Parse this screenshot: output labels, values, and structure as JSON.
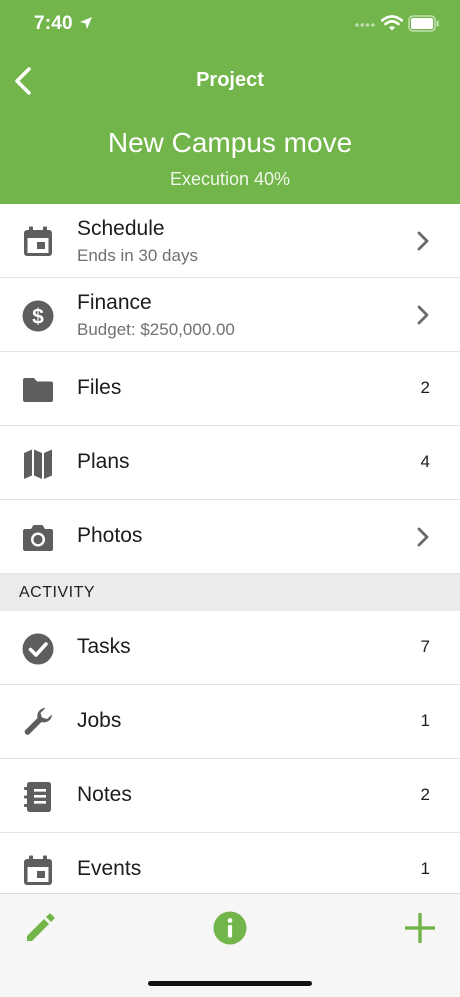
{
  "status_bar": {
    "time": "7:40"
  },
  "header": {
    "title": "Project",
    "project_name": "New Campus move",
    "project_status": "Execution 40%",
    "background_color": "#72b54a"
  },
  "main_items": [
    {
      "icon": "calendar-icon",
      "title": "Schedule",
      "subtitle": "Ends in 30 days",
      "accessory": "chevron"
    },
    {
      "icon": "dollar-icon",
      "title": "Finance",
      "subtitle": "Budget: $250,000.00",
      "accessory": "chevron"
    },
    {
      "icon": "folder-icon",
      "title": "Files",
      "count": "2"
    },
    {
      "icon": "map-icon",
      "title": "Plans",
      "count": "4"
    },
    {
      "icon": "camera-icon",
      "title": "Photos",
      "accessory": "chevron"
    }
  ],
  "activity": {
    "header": "ACTIVITY",
    "items": [
      {
        "icon": "checkmark-icon",
        "title": "Tasks",
        "count": "7"
      },
      {
        "icon": "wrench-icon",
        "title": "Jobs",
        "count": "1"
      },
      {
        "icon": "notebook-icon",
        "title": "Notes",
        "count": "2"
      },
      {
        "icon": "calendar-icon",
        "title": "Events",
        "count": "1"
      }
    ]
  },
  "toolbar": {
    "edit_icon": "pencil-icon",
    "info_icon": "info-icon",
    "add_icon": "plus-icon",
    "accent_color": "#72b54a"
  }
}
